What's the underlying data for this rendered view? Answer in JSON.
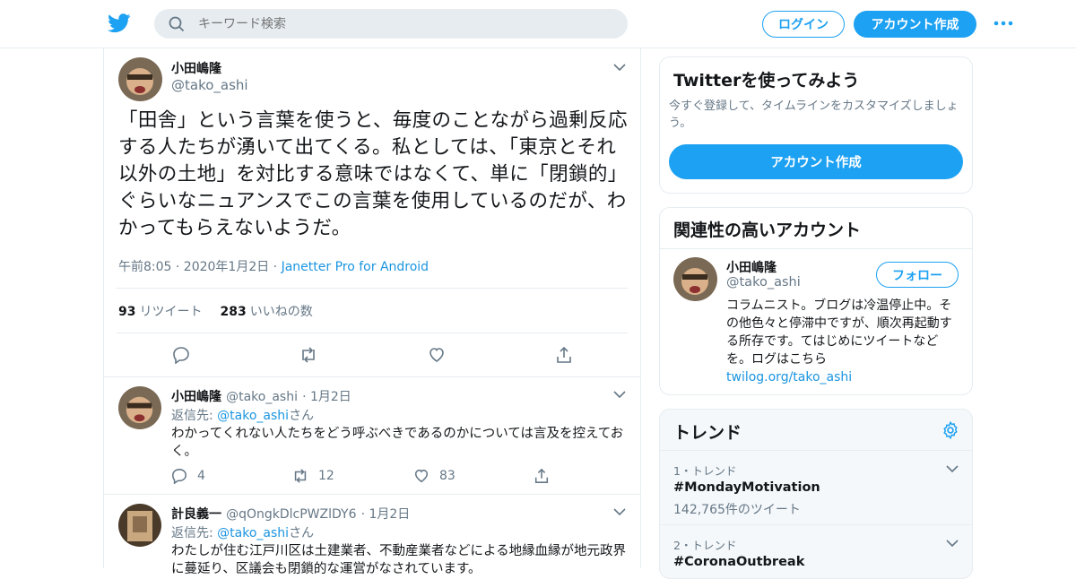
{
  "header": {
    "search_placeholder": "キーワード検索",
    "login_label": "ログイン",
    "signup_label": "アカウント作成"
  },
  "tweet": {
    "author_name": "小田嶋隆",
    "author_handle": "@tako_ashi",
    "text": "「田舎」という言葉を使うと、毎度のことながら過剰反応する人たちが湧いて出てくる。私としては、「東京とそれ以外の土地」を対比する意味ではなくて、単に「閉鎖的」ぐらいなニュアンスでこの言葉を使用しているのだが、わかってもらえないようだ。",
    "time": "午前8:05 · 2020年1月2日 · ",
    "client": "Janetter Pro for Android",
    "retweets_count": "93",
    "retweets_label": "リツイート",
    "likes_count": "283",
    "likes_label": "いいねの数"
  },
  "replies": [
    {
      "name": "小田嶋隆",
      "handle": "@tako_ashi",
      "date": "· 1月2日",
      "reply_to_prefix": "返信先: ",
      "reply_to": "@tako_ashi",
      "reply_to_suffix": "さん",
      "text": "わかってくれない人たちをどう呼ぶべきであるのかについては言及を控えておく。",
      "reply_count": "4",
      "retweet_count": "12",
      "like_count": "83"
    },
    {
      "name": "計良義一",
      "handle": "@qOngkDlcPWZlDY6",
      "date": "· 1月2日",
      "reply_to_prefix": "返信先: ",
      "reply_to": "@tako_ashi",
      "reply_to_suffix": "さん",
      "text": "わたしが住む江戸川区は土建業者、不動産業者などによる地縁血縁が地元政界に蔓延り、区議会も閉鎖的な運営がなされています。"
    }
  ],
  "signup_card": {
    "title": "Twitterを使ってみよう",
    "desc": "今すぐ登録して、タイムラインをカスタマイズしましょう。",
    "button": "アカウント作成"
  },
  "related_card": {
    "title": "関連性の高いアカウント",
    "name": "小田嶋隆",
    "handle": "@tako_ashi",
    "follow_label": "フォロー",
    "bio": "コラムニスト。ブログは冷温停止中。その他色々と停滞中ですが、順次再起動する所存です。てはじめにツイートなどを。ログはこちら",
    "link": "twilog.org/tako_ashi"
  },
  "trends": {
    "title": "トレンド",
    "items": [
      {
        "rank": "1・トレンド",
        "tag": "#MondayMotivation",
        "count": "142,765件のツイート"
      },
      {
        "rank": "2・トレンド",
        "tag": "#CoronaOutbreak",
        "count": ""
      }
    ]
  },
  "colors": {
    "accent": "#1da1f2",
    "border": "#e6ecf0",
    "muted": "#657786",
    "link": "#1b95e0"
  }
}
